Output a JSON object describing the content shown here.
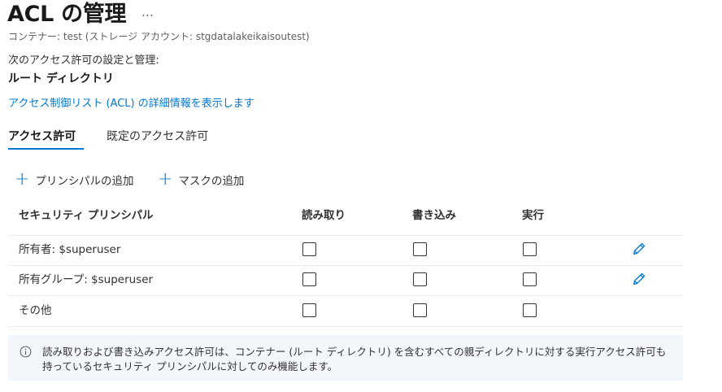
{
  "header": {
    "title": "ACL の管理",
    "more_label": "…",
    "subtitle": "コンテナー: test (ストレージ アカウント: stgdatalakeikaisoutest)"
  },
  "intro": {
    "description": "次のアクセス許可の設定と管理:",
    "directory": "ルート ディレクトリ",
    "learn_more_link": "アクセス制御リスト (ACL) の詳細情報を表示します"
  },
  "tabs": [
    {
      "label": "アクセス許可",
      "active": true
    },
    {
      "label": "既定のアクセス許可",
      "active": false
    }
  ],
  "commands": {
    "add_principal": "プリンシパルの追加",
    "add_mask": "マスクの追加",
    "icon": "plus-icon"
  },
  "table": {
    "columns": [
      "セキュリティ プリンシパル",
      "読み取り",
      "書き込み",
      "実行"
    ],
    "rows": [
      {
        "principal": "所有者: $superuser",
        "read": false,
        "write": false,
        "execute": false,
        "editable": true
      },
      {
        "principal": "所有グループ: $superuser",
        "read": false,
        "write": false,
        "execute": false,
        "editable": true
      },
      {
        "principal": "その他",
        "read": false,
        "write": false,
        "execute": false,
        "editable": false
      }
    ]
  },
  "info": {
    "icon": "info-icon",
    "text": "読み取りおよび書き込みアクセス許可は、コンテナー (ルート ディレクトリ) を含むすべての親ディレクトリに対する実行アクセス許可も持っているセキュリティ プリンシパルに対してのみ機能します。"
  },
  "colors": {
    "accent": "#0078d4",
    "info_background": "#f3f7fc",
    "text": "#323130"
  }
}
